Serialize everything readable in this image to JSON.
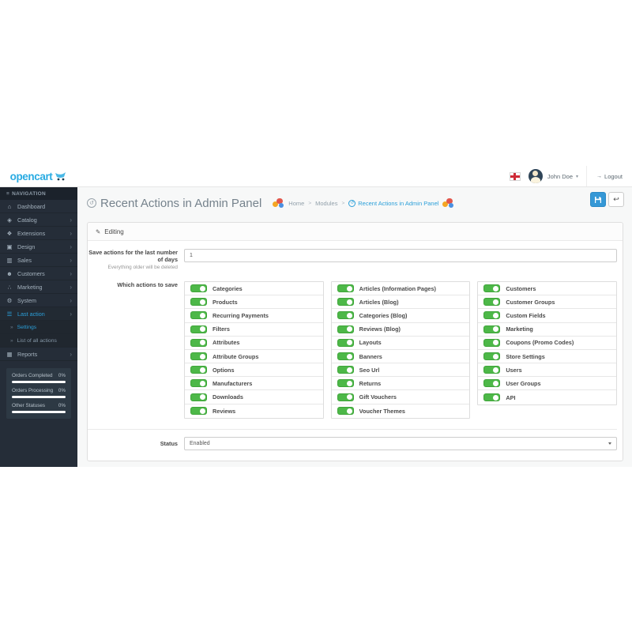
{
  "topbar": {
    "logo_text": "opencart",
    "user_name": "John Doe",
    "logout_label": "Logout"
  },
  "sidebar": {
    "nav_header": "NAVIGATION",
    "items": [
      {
        "label": "Dashboard",
        "icon": "⌂"
      },
      {
        "label": "Catalog",
        "icon": "◈",
        "has_submenu": true
      },
      {
        "label": "Extensions",
        "icon": "❖",
        "has_submenu": true
      },
      {
        "label": "Design",
        "icon": "▣",
        "has_submenu": true
      },
      {
        "label": "Sales",
        "icon": "▥",
        "has_submenu": true
      },
      {
        "label": "Customers",
        "icon": "☻",
        "has_submenu": true
      },
      {
        "label": "Marketing",
        "icon": "∴",
        "has_submenu": true
      },
      {
        "label": "System",
        "icon": "⚙",
        "has_submenu": true
      },
      {
        "label": "Last action",
        "icon": "☰",
        "has_submenu": true,
        "active": true
      },
      {
        "label": "Settings",
        "sub": true,
        "active": true
      },
      {
        "label": "List of all actions",
        "sub": true
      },
      {
        "label": "Reports",
        "icon": "▦",
        "has_submenu": true
      }
    ],
    "stats": [
      {
        "label": "Orders Completed",
        "value": "0%"
      },
      {
        "label": "Orders Processing",
        "value": "0%"
      },
      {
        "label": "Other Statuses",
        "value": "0%"
      }
    ]
  },
  "page": {
    "title": "Recent Actions in Admin Panel",
    "breadcrumb": {
      "home": "Home",
      "modules": "Modules",
      "current": "Recent Actions in Admin Panel",
      "separator": ">"
    }
  },
  "panel": {
    "heading": "Editing",
    "days": {
      "label": "Save actions for the last number of days",
      "help": "Everything older will be deleted",
      "value": "1"
    },
    "actions_label": "Which actions to save",
    "all_toggles_enabled": true,
    "columns": [
      [
        "Categories",
        "Products",
        "Recurring Payments",
        "Filters",
        "Attributes",
        "Attribute Groups",
        "Options",
        "Manufacturers",
        "Downloads",
        "Reviews"
      ],
      [
        "Articles (Information Pages)",
        "Articles (Blog)",
        "Categories (Blog)",
        "Reviews (Blog)",
        "Layouts",
        "Banners",
        "Seo Url",
        "Returns",
        "Gift Vouchers",
        "Voucher Themes"
      ],
      [
        "Customers",
        "Customer Groups",
        "Custom Fields",
        "Marketing",
        "Coupons (Promo Codes)",
        "Store Settings",
        "Users",
        "User Groups",
        "API"
      ]
    ],
    "status": {
      "label": "Status",
      "value": "Enabled"
    }
  },
  "colors": {
    "accent_blue": "#2b9fd9",
    "toggle_green": "#4db848",
    "sidebar_bg": "#252d38",
    "logo_blue": "#29abe2"
  },
  "ui": {
    "chevron": "›",
    "sub_bullet": "»",
    "caret": "▾",
    "nav_burger": "≡",
    "pencil": "✎",
    "back_icon": "↩",
    "history_icon": "↺",
    "logout_icon": "→"
  }
}
